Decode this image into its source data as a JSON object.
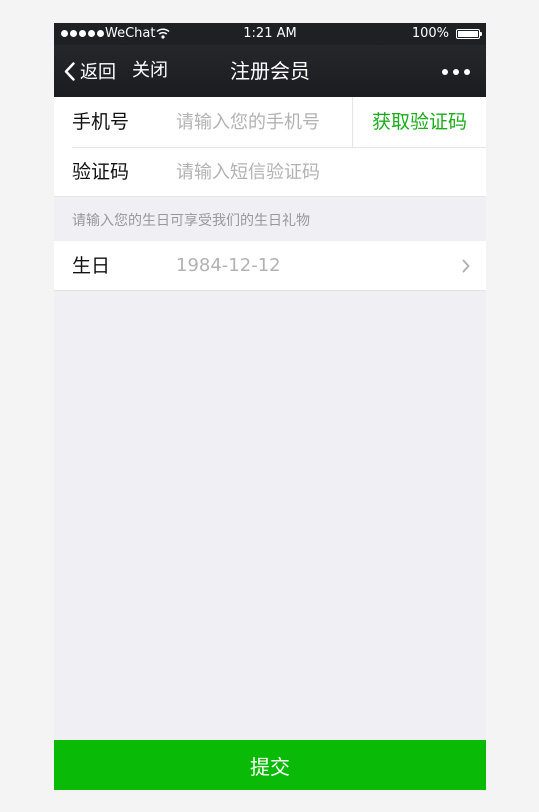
{
  "status_bar": {
    "carrier": "WeChat",
    "time": "1:21 AM",
    "battery": "100%"
  },
  "nav": {
    "back_label": "返回",
    "close_label": "关闭",
    "title": "注册会员"
  },
  "form": {
    "phone": {
      "label": "手机号",
      "placeholder": "请输入您的手机号",
      "get_code_label": "获取验证码"
    },
    "code": {
      "label": "验证码",
      "placeholder": "请输入短信验证码"
    },
    "birthday_hint": "请输入您的生日可享受我们的生日礼物",
    "birthday": {
      "label": "生日",
      "value": "1984-12-12"
    }
  },
  "submit_label": "提交",
  "colors": {
    "accent": "#09bb07",
    "link_green": "#1aad19",
    "nav_background": "#1f2023",
    "page_background": "#efeff4"
  },
  "icons": [
    "wifi-icon",
    "battery-icon",
    "back-chevron-icon",
    "more-icon",
    "chevron-right-icon"
  ]
}
